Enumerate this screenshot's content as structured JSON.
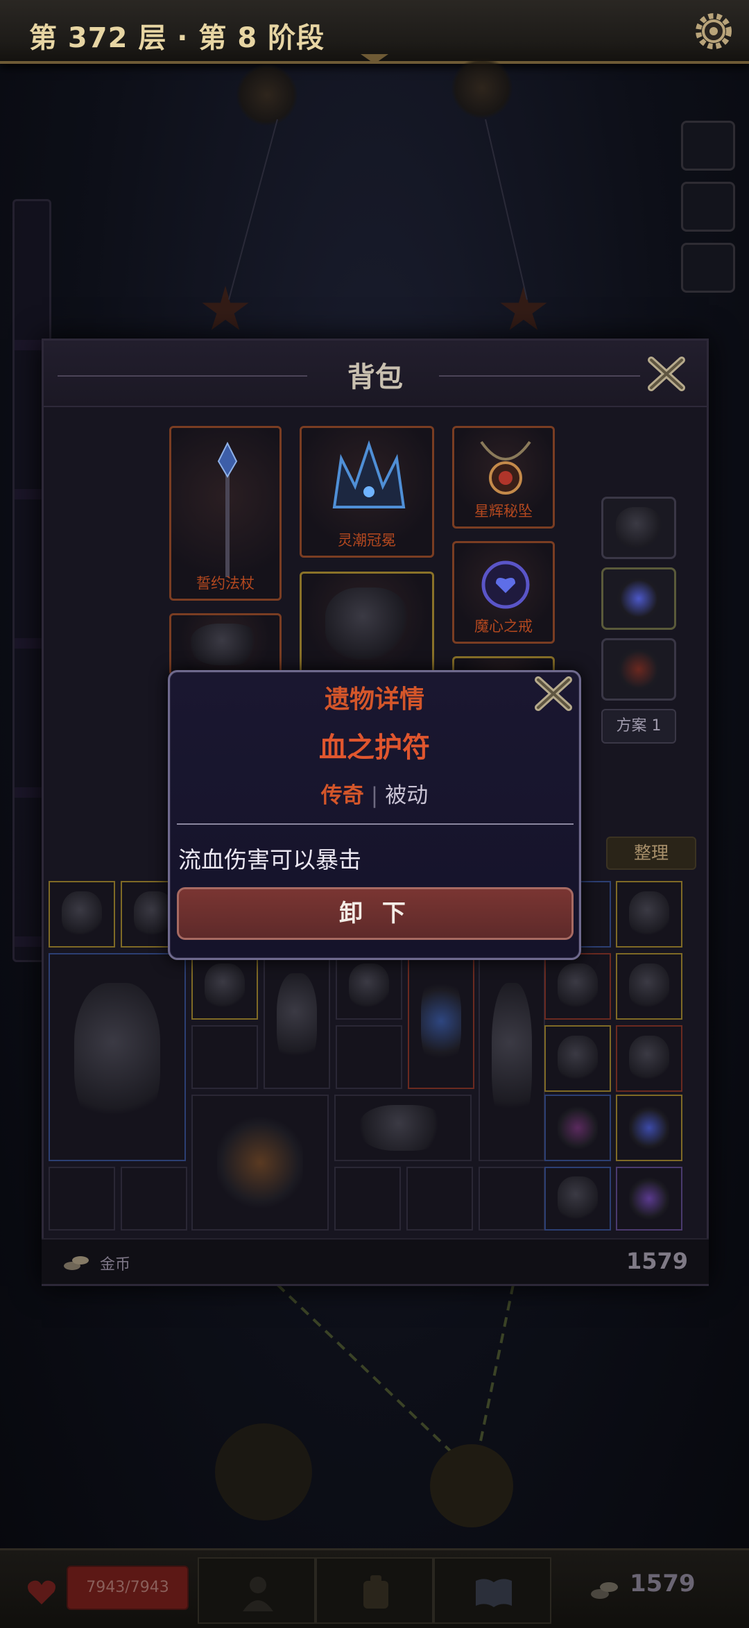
{
  "header": {
    "floor_title": "第 372 层 · 第 8 阶段"
  },
  "inventory": {
    "title": "背包",
    "equipped": [
      {
        "name": "誓约法杖",
        "rarity_color": "#7a3d22"
      },
      {
        "name": "灵潮冠冕",
        "rarity_color": "#7a3d22"
      },
      {
        "name": "星辉秘坠",
        "rarity_color": "#7a3d22"
      },
      {
        "name": "魔心之戒",
        "rarity_color": "#7a3d22"
      }
    ],
    "scheme_label": "方案 1",
    "sort_label": "整理",
    "currency_label": "金币",
    "currency_value": "1579"
  },
  "modal": {
    "heading": "遗物详情",
    "item_name": "血之护符",
    "rarity": "传奇",
    "separator": "|",
    "type": "被动",
    "description": "流血伤害可以暴击",
    "action_label": "卸 下"
  },
  "bottom_bar": {
    "hp": "7943/7943",
    "gold": "1579"
  },
  "colors": {
    "legendary": "#d4562a",
    "panel_bg": "#171520",
    "modal_border": "#6f6a8e",
    "button_bg": "#7a3532"
  }
}
